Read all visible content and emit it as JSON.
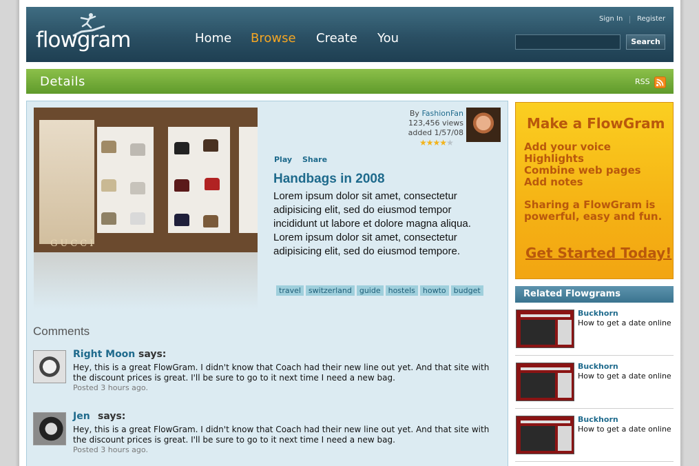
{
  "header": {
    "logo_text": "flowgram",
    "nav": [
      "Home",
      "Browse",
      "Create",
      "You"
    ],
    "sign_in": "Sign In",
    "register": "Register",
    "search_button": "Search",
    "search_value": ""
  },
  "details_bar": {
    "title": "Details",
    "rss": "RSS"
  },
  "item": {
    "by_prefix": "By ",
    "author": "FashionFan",
    "views": "123,456 views",
    "added": "added 1/57/08",
    "rating_stars": 4,
    "rating_max": 5,
    "play": "Play",
    "share": "Share",
    "title": "Handbags in 2008",
    "description": "Lorem ipsum dolor sit amet, consectetur adipisicing elit, sed do eiusmod tempor incididunt ut labore et dolore magna aliqua. Lorem ipsum dolor sit amet, consectetur adipisicing elit, sed do eiusmod tempore.",
    "tags": [
      "travel",
      "switzerland",
      "guide",
      "hostels",
      "howto",
      "budget"
    ],
    "thumbnail_brand": "GUCCI"
  },
  "comments": {
    "title": "Comments",
    "items": [
      {
        "name": "Right Moon",
        "says": "says:",
        "text": "Hey, this is a great FlowGram. I didn't know that Coach had their new line out yet. And that site with the discount prices is great. I'll be sure to go to it next time I need a new bag.",
        "time": "Posted 3 hours ago."
      },
      {
        "name": "Jen",
        "says": "says:",
        "text": "Hey, this is a great FlowGram. I didn't know that Coach had their new line out yet. And that site with the discount prices is great. I'll be sure to go to it next time I need a new bag.",
        "time": "Posted 3 hours ago."
      }
    ]
  },
  "ad": {
    "title": "Make a FlowGram",
    "features": [
      "Add your voice",
      "Highlights",
      "Combine web pages",
      "Add notes"
    ],
    "pitch": "Sharing a FlowGram is powerful, easy and fun.",
    "cta": "Get Started Today!"
  },
  "related": {
    "title": "Related Flowgrams",
    "items": [
      {
        "name": "Buckhorn",
        "desc": "How to get a date online"
      },
      {
        "name": "Buckhorn",
        "desc": "How to get a date online"
      },
      {
        "name": "Buckhorn",
        "desc": "How to get a date online"
      }
    ]
  },
  "colors": {
    "accent_blue": "#1e6a8c",
    "active_nav": "#f5a623",
    "green_bar": "#6ea833",
    "ad_orange": "#b9580c"
  }
}
